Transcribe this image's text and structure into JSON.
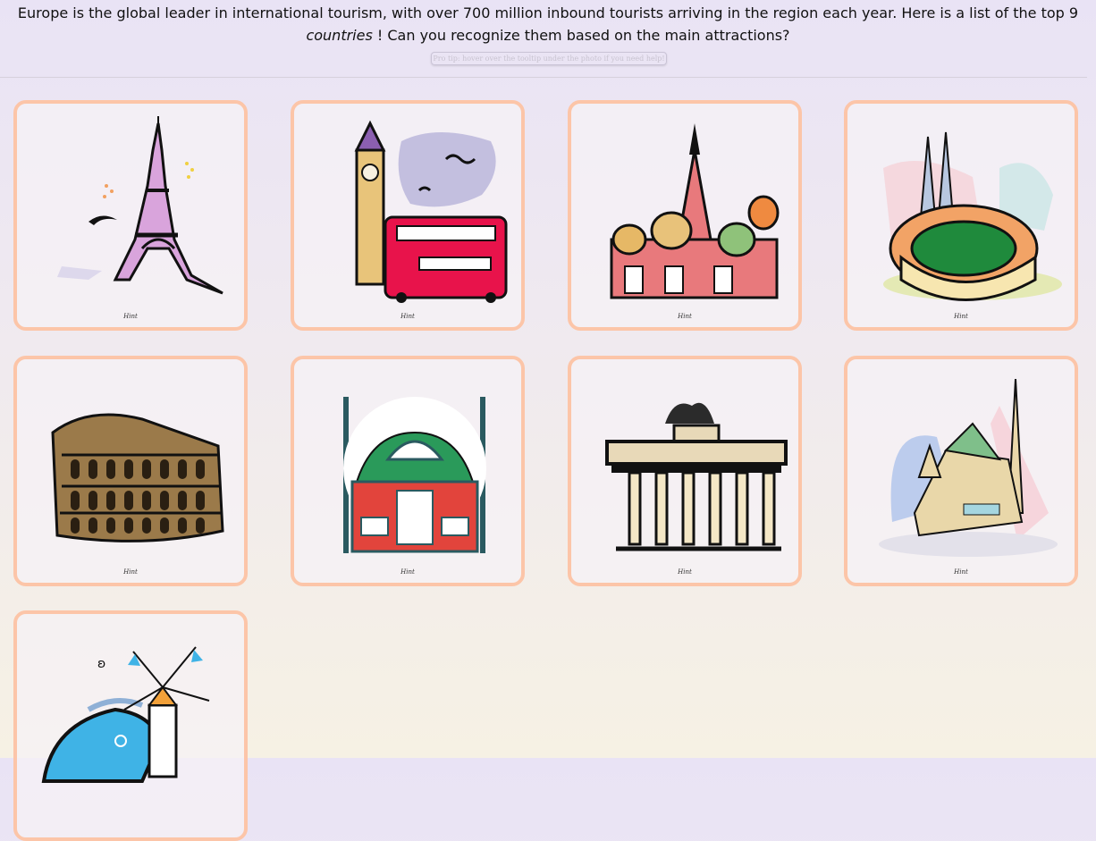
{
  "intro": {
    "text_before": "Europe is the global leader in international tourism, with over 700 million inbound tourists arriving in the region each year. Here is a list of the top 9 ",
    "emphasis": "countries",
    "text_after": " ! Can you recognize them based on the main attractions?"
  },
  "tip": "Pro tip: hover over the tooltip under the photo if you need help!",
  "cards": [
    {
      "hint": "Hint",
      "icon": "eiffel-tower-icon"
    },
    {
      "hint": "Hint",
      "icon": "big-ben-bus-icon"
    },
    {
      "hint": "Hint",
      "icon": "st-basils-cathedral-icon"
    },
    {
      "hint": "Hint",
      "icon": "sagrada-familia-stadium-icon"
    },
    {
      "hint": "Hint",
      "icon": "colosseum-icon"
    },
    {
      "hint": "Hint",
      "icon": "hagia-sophia-icon"
    },
    {
      "hint": "Hint",
      "icon": "brandenburg-gate-icon"
    },
    {
      "hint": "Hint",
      "icon": "st-stephens-cathedral-icon"
    },
    {
      "hint": "",
      "icon": "greek-windmill-icon"
    }
  ]
}
